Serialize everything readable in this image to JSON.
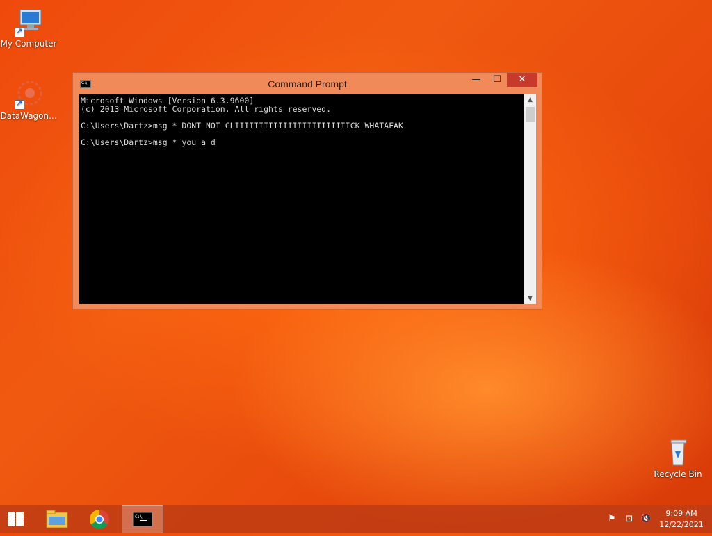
{
  "desktop": {
    "icons": [
      {
        "label": "My Computer",
        "icon": "computer-icon"
      },
      {
        "label": "DataWagon...",
        "icon": "datawagon-icon"
      },
      {
        "label": "Recycle Bin",
        "icon": "recycle-bin-icon"
      }
    ]
  },
  "window": {
    "title": "Command Prompt",
    "icon": "cmd-icon",
    "minimize": "—",
    "maximize": "☐",
    "close": "✕",
    "console_lines": [
      "Microsoft Windows [Version 6.3.9600]",
      "(c) 2013 Microsoft Corporation. All rights reserved.",
      "",
      "C:\\Users\\Dartz>msg * DONT NOT CLIIIIIIIIIIIIIIIIIIIIIIIICK WHATAFAK",
      "",
      "C:\\Users\\Dartz>msg * you a d"
    ],
    "scroll_up": "▲",
    "scroll_down": "▼"
  },
  "taskbar": {
    "start": "windows-logo-icon",
    "pinned": [
      {
        "name": "file-explorer-icon"
      },
      {
        "name": "chrome-icon"
      },
      {
        "name": "cmd-icon",
        "active": true
      }
    ],
    "tray": [
      "action-center-flag-icon",
      "network-icon",
      "volume-muted-icon"
    ],
    "time": "9:09 AM",
    "date": "12/22/2021"
  }
}
